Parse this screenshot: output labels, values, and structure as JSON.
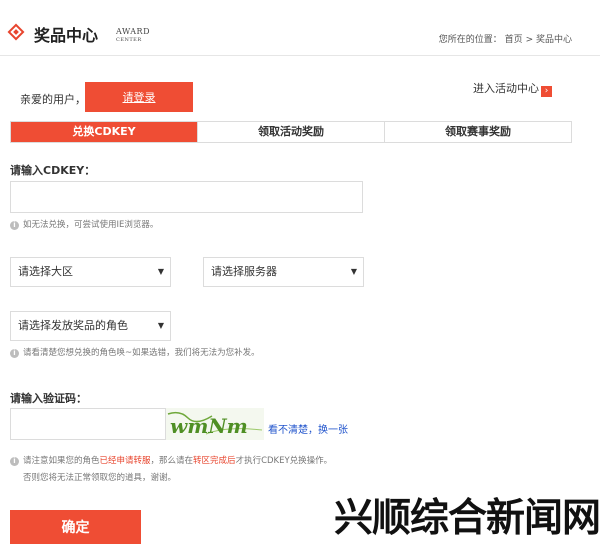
{
  "header": {
    "title": "奖品中心",
    "title_en_line1": "AWARD",
    "title_en_line2": "CENTER",
    "breadcrumb_prefix": "您所在的位置：",
    "breadcrumb_home": "首页",
    "breadcrumb_sep": ">",
    "breadcrumb_current": "奖品中心"
  },
  "user": {
    "greeting": "亲爱的用户，",
    "login_label": "请登录",
    "enter_center_label": "进入活动中心"
  },
  "tabs": [
    {
      "label": "兑换CDKEY",
      "active": true
    },
    {
      "label": "领取活动奖励",
      "active": false
    },
    {
      "label": "领取赛事奖励",
      "active": false
    }
  ],
  "form": {
    "cdkey_label": "请输入CDKEY：",
    "cdkey_value": "",
    "cdkey_hint": "如无法兑换，可尝试使用IE浏览器。",
    "region_select": "请选择大区",
    "server_select": "请选择服务器",
    "role_select": "请选择发放奖品的角色",
    "role_hint": "请看清楚您想兑换的角色唤~如果选错，我们将无法为您补发。",
    "captcha_label": "请输入验证码：",
    "captcha_value": "",
    "captcha_text": "wmNm",
    "captcha_refresh": "看不清楚，换一张",
    "notice_part1": "请注意如果您的角色",
    "notice_red1": "已经申请转服",
    "notice_part2": "，那么请在",
    "notice_red2": "转区完成后",
    "notice_part3": "才执行CDKEY兑换操作。",
    "notice_line2": "否则您将无法正常领取您的道具，谢谢。",
    "confirm_label": "确定"
  },
  "watermark": "兴顺综合新闻网",
  "colors": {
    "accent": "#ef4d34",
    "link": "#2255cc",
    "border": "#dcdcdc"
  }
}
